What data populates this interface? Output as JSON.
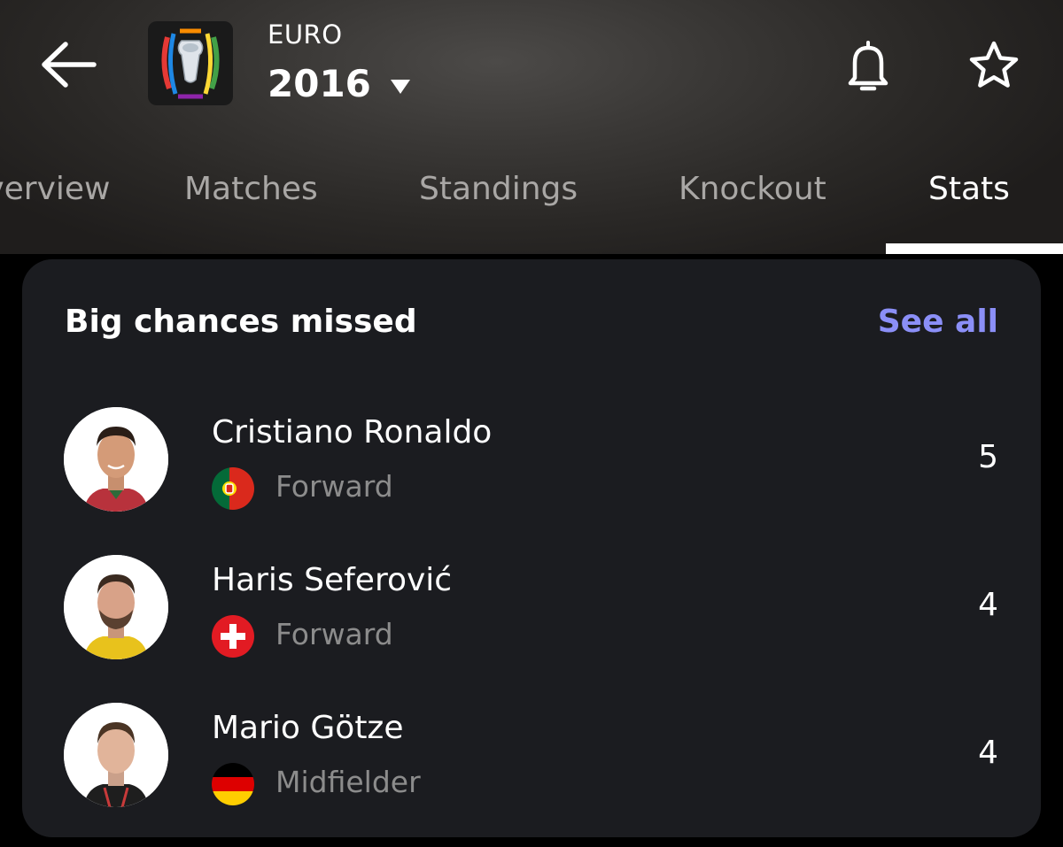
{
  "header": {
    "competition": "EURO",
    "season": "2016",
    "icons": {
      "back": "arrow-left-icon",
      "logo": "euro-trophy-logo",
      "notifications": "bell-icon",
      "favorite": "star-outline-icon"
    }
  },
  "tabs": [
    {
      "label": "Overview",
      "active": false
    },
    {
      "label": "Matches",
      "active": false
    },
    {
      "label": "Standings",
      "active": false
    },
    {
      "label": "Knockout",
      "active": false
    },
    {
      "label": "Stats",
      "active": true
    }
  ],
  "card": {
    "title": "Big chances missed",
    "see_all": "See all",
    "players": [
      {
        "name": "Cristiano Ronaldo",
        "position": "Forward",
        "country_flag": "portugal-flag",
        "value": "5"
      },
      {
        "name": "Haris Seferović",
        "position": "Forward",
        "country_flag": "switzerland-flag",
        "value": "4"
      },
      {
        "name": "Mario Götze",
        "position": "Midfielder",
        "country_flag": "germany-flag",
        "value": "4"
      }
    ]
  },
  "colors": {
    "card_bg": "#1b1c20",
    "accent": "#8b8ff7",
    "muted_text": "#8c8c8c",
    "inactive_tab": "#a9a7a5"
  }
}
